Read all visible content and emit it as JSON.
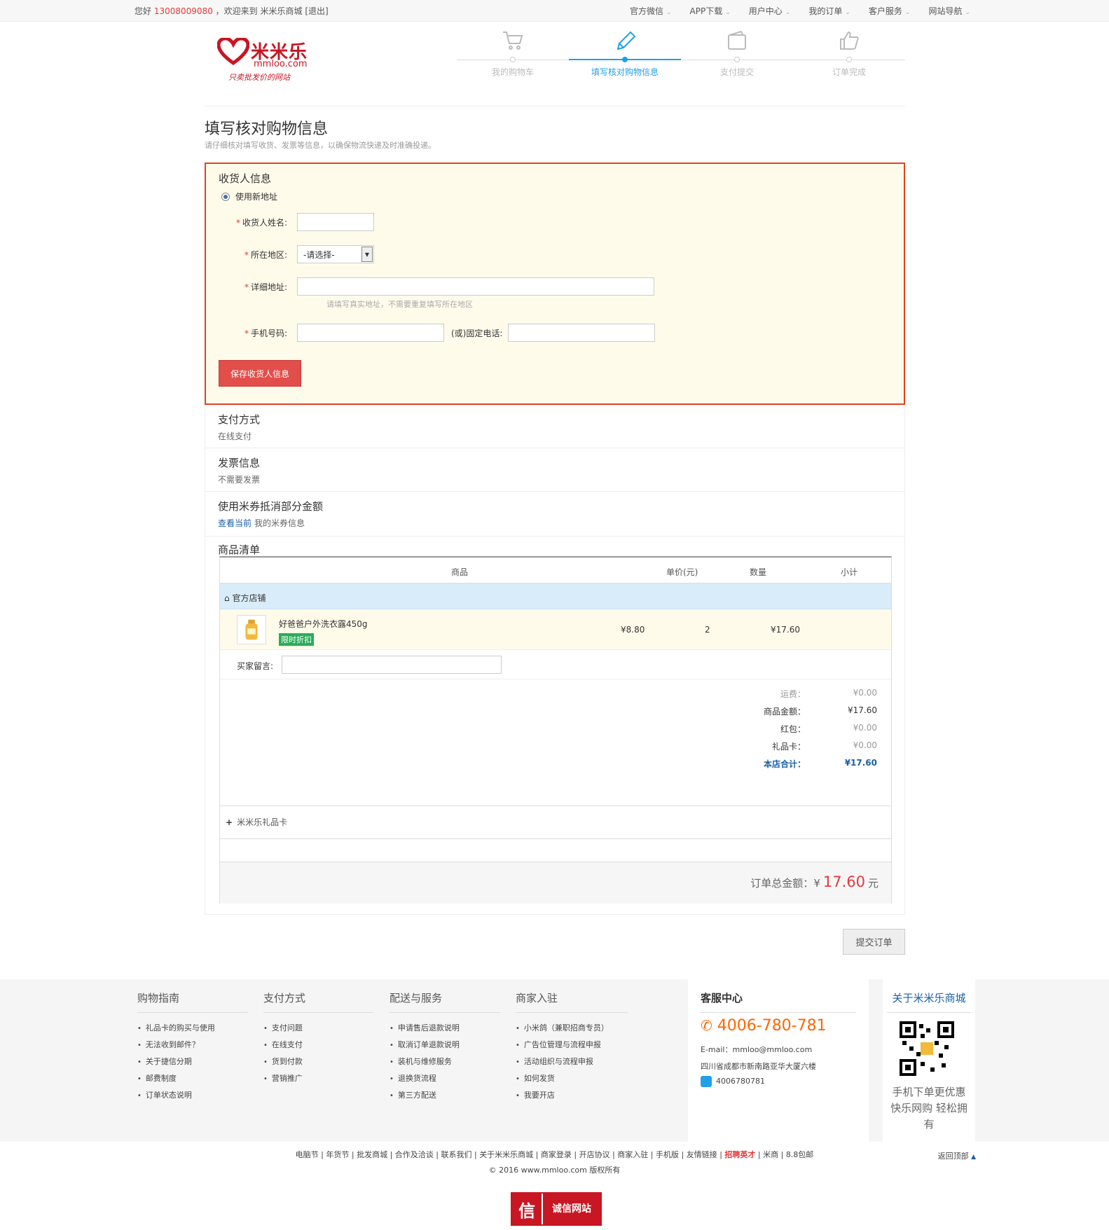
{
  "topbar": {
    "greet_prefix": "您好",
    "phone": "13008009080",
    "greet_mid": "，欢迎来到",
    "site": "米米乐商城",
    "logout": "[退出]",
    "links": [
      "官方微信",
      "APP下载",
      "用户中心",
      "我的订单",
      "客户服务",
      "网站导航"
    ]
  },
  "logo": {
    "text": "米米乐",
    "domain": "mmloo.com",
    "slogan": "只卖批发价的网站"
  },
  "steps": [
    "我的购物车",
    "填写核对购物信息",
    "支付提交",
    "订单完成"
  ],
  "page": {
    "title": "填写核对购物信息",
    "subtitle": "请仔细核对填写收货、发票等信息，以确保物流快递及时准确投递。"
  },
  "receiver": {
    "title": "收货人信息",
    "use_new": "使用新地址",
    "name_label": "收货人姓名:",
    "region_label": "所在地区:",
    "region_value": "-请选择-",
    "address_label": "详细地址:",
    "address_hint": "请填写真实地址，不需要重复填写所在地区",
    "mobile_label": "手机号码:",
    "tel_label": "(或)固定电话:",
    "save": "保存收货人信息"
  },
  "payment": {
    "title": "支付方式",
    "value": "在线支付"
  },
  "invoice": {
    "title": "发票信息",
    "value": "不需要发票"
  },
  "coupon": {
    "title": "使用米券抵消部分金额",
    "link": "查看当前",
    "value": "我的米券信息"
  },
  "goods": {
    "title": "商品清单",
    "headers": [
      "商品",
      "单价(元)",
      "数量",
      "小计"
    ],
    "shop": "官方店铺",
    "item": {
      "name": "好爸爸户外洗衣露450g",
      "tag": "限时折扣",
      "price": "¥8.80",
      "qty": "2",
      "subtotal": "¥17.60"
    },
    "message_label": "买家留言:",
    "summary": [
      {
        "k": "运费：",
        "v": "¥0.00"
      },
      {
        "k": "商品金额：",
        "v": "¥17.60"
      },
      {
        "k": "红包：",
        "v": "¥0.00"
      },
      {
        "k": "礼品卡：",
        "v": "¥0.00"
      },
      {
        "k": "本店合计：",
        "v": "¥17.60"
      }
    ],
    "gift_card": "米米乐礼品卡",
    "total_label": "订单总金额：",
    "currency": "¥",
    "total": "17.60",
    "unit": "元"
  },
  "submit": "提交订单",
  "footer": {
    "cols": [
      {
        "h": "购物指南",
        "items": [
          "礼品卡的购买与使用",
          "无法收到邮件？",
          "关于捷信分期",
          "邮费制度",
          "订单状态说明"
        ]
      },
      {
        "h": "支付方式",
        "items": [
          "支付问题",
          "在线支付",
          "货到付款",
          "营销推广"
        ]
      },
      {
        "h": "配送与服务",
        "items": [
          "申请售后退款说明",
          "取消订单退款说明",
          "装机与维修服务",
          "退换货流程",
          "第三方配送"
        ]
      },
      {
        "h": "商家入驻",
        "items": [
          "小米鸽（兼职招商专员）",
          "广告位管理与流程申报",
          "活动组织与流程申报",
          "如何发货",
          "我要开店"
        ]
      }
    ],
    "cs_title": "客服中心",
    "cs_tel": "4006-780-781",
    "cs_mail": "E-mail：mmloo@mmloo.com",
    "cs_addr": "四川省成都市新南路亚华大厦六楼",
    "cs_qq": "4006780781",
    "about_title": "关于米米乐商城",
    "about_text": "手机下单更优惠 快乐网购 轻松拥有"
  },
  "bottom": {
    "links": [
      "电脑节",
      "年货节",
      "批发商城",
      "合作及洽谈",
      "联系我们",
      "关于米米乐商城",
      "商家登录",
      "开店协议",
      "商家入驻",
      "手机版",
      "友情链接",
      "招聘英才",
      "米商",
      "8.8包邮"
    ],
    "copyright": "© 2016 www.mmloo.com 版权所有",
    "backtop": "返回顶部",
    "trust_badge": "信",
    "trust": "诚信网站"
  },
  "colors": {
    "accent": "#1fa0e8",
    "brand": "#c81623",
    "price": "#e4393c",
    "save_button": "#e24e4a"
  }
}
